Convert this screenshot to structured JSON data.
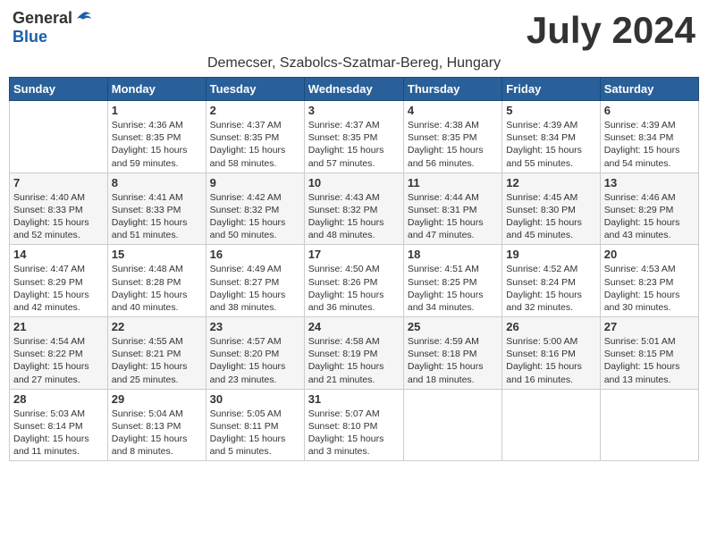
{
  "header": {
    "logo_general": "General",
    "logo_blue": "Blue",
    "month_year": "July 2024",
    "location": "Demecser, Szabolcs-Szatmar-Bereg, Hungary"
  },
  "days_of_week": [
    "Sunday",
    "Monday",
    "Tuesday",
    "Wednesday",
    "Thursday",
    "Friday",
    "Saturday"
  ],
  "weeks": [
    [
      {
        "num": "",
        "sunrise": "",
        "sunset": "",
        "daylight": ""
      },
      {
        "num": "1",
        "sunrise": "Sunrise: 4:36 AM",
        "sunset": "Sunset: 8:35 PM",
        "daylight": "Daylight: 15 hours and 59 minutes."
      },
      {
        "num": "2",
        "sunrise": "Sunrise: 4:37 AM",
        "sunset": "Sunset: 8:35 PM",
        "daylight": "Daylight: 15 hours and 58 minutes."
      },
      {
        "num": "3",
        "sunrise": "Sunrise: 4:37 AM",
        "sunset": "Sunset: 8:35 PM",
        "daylight": "Daylight: 15 hours and 57 minutes."
      },
      {
        "num": "4",
        "sunrise": "Sunrise: 4:38 AM",
        "sunset": "Sunset: 8:35 PM",
        "daylight": "Daylight: 15 hours and 56 minutes."
      },
      {
        "num": "5",
        "sunrise": "Sunrise: 4:39 AM",
        "sunset": "Sunset: 8:34 PM",
        "daylight": "Daylight: 15 hours and 55 minutes."
      },
      {
        "num": "6",
        "sunrise": "Sunrise: 4:39 AM",
        "sunset": "Sunset: 8:34 PM",
        "daylight": "Daylight: 15 hours and 54 minutes."
      }
    ],
    [
      {
        "num": "7",
        "sunrise": "Sunrise: 4:40 AM",
        "sunset": "Sunset: 8:33 PM",
        "daylight": "Daylight: 15 hours and 52 minutes."
      },
      {
        "num": "8",
        "sunrise": "Sunrise: 4:41 AM",
        "sunset": "Sunset: 8:33 PM",
        "daylight": "Daylight: 15 hours and 51 minutes."
      },
      {
        "num": "9",
        "sunrise": "Sunrise: 4:42 AM",
        "sunset": "Sunset: 8:32 PM",
        "daylight": "Daylight: 15 hours and 50 minutes."
      },
      {
        "num": "10",
        "sunrise": "Sunrise: 4:43 AM",
        "sunset": "Sunset: 8:32 PM",
        "daylight": "Daylight: 15 hours and 48 minutes."
      },
      {
        "num": "11",
        "sunrise": "Sunrise: 4:44 AM",
        "sunset": "Sunset: 8:31 PM",
        "daylight": "Daylight: 15 hours and 47 minutes."
      },
      {
        "num": "12",
        "sunrise": "Sunrise: 4:45 AM",
        "sunset": "Sunset: 8:30 PM",
        "daylight": "Daylight: 15 hours and 45 minutes."
      },
      {
        "num": "13",
        "sunrise": "Sunrise: 4:46 AM",
        "sunset": "Sunset: 8:29 PM",
        "daylight": "Daylight: 15 hours and 43 minutes."
      }
    ],
    [
      {
        "num": "14",
        "sunrise": "Sunrise: 4:47 AM",
        "sunset": "Sunset: 8:29 PM",
        "daylight": "Daylight: 15 hours and 42 minutes."
      },
      {
        "num": "15",
        "sunrise": "Sunrise: 4:48 AM",
        "sunset": "Sunset: 8:28 PM",
        "daylight": "Daylight: 15 hours and 40 minutes."
      },
      {
        "num": "16",
        "sunrise": "Sunrise: 4:49 AM",
        "sunset": "Sunset: 8:27 PM",
        "daylight": "Daylight: 15 hours and 38 minutes."
      },
      {
        "num": "17",
        "sunrise": "Sunrise: 4:50 AM",
        "sunset": "Sunset: 8:26 PM",
        "daylight": "Daylight: 15 hours and 36 minutes."
      },
      {
        "num": "18",
        "sunrise": "Sunrise: 4:51 AM",
        "sunset": "Sunset: 8:25 PM",
        "daylight": "Daylight: 15 hours and 34 minutes."
      },
      {
        "num": "19",
        "sunrise": "Sunrise: 4:52 AM",
        "sunset": "Sunset: 8:24 PM",
        "daylight": "Daylight: 15 hours and 32 minutes."
      },
      {
        "num": "20",
        "sunrise": "Sunrise: 4:53 AM",
        "sunset": "Sunset: 8:23 PM",
        "daylight": "Daylight: 15 hours and 30 minutes."
      }
    ],
    [
      {
        "num": "21",
        "sunrise": "Sunrise: 4:54 AM",
        "sunset": "Sunset: 8:22 PM",
        "daylight": "Daylight: 15 hours and 27 minutes."
      },
      {
        "num": "22",
        "sunrise": "Sunrise: 4:55 AM",
        "sunset": "Sunset: 8:21 PM",
        "daylight": "Daylight: 15 hours and 25 minutes."
      },
      {
        "num": "23",
        "sunrise": "Sunrise: 4:57 AM",
        "sunset": "Sunset: 8:20 PM",
        "daylight": "Daylight: 15 hours and 23 minutes."
      },
      {
        "num": "24",
        "sunrise": "Sunrise: 4:58 AM",
        "sunset": "Sunset: 8:19 PM",
        "daylight": "Daylight: 15 hours and 21 minutes."
      },
      {
        "num": "25",
        "sunrise": "Sunrise: 4:59 AM",
        "sunset": "Sunset: 8:18 PM",
        "daylight": "Daylight: 15 hours and 18 minutes."
      },
      {
        "num": "26",
        "sunrise": "Sunrise: 5:00 AM",
        "sunset": "Sunset: 8:16 PM",
        "daylight": "Daylight: 15 hours and 16 minutes."
      },
      {
        "num": "27",
        "sunrise": "Sunrise: 5:01 AM",
        "sunset": "Sunset: 8:15 PM",
        "daylight": "Daylight: 15 hours and 13 minutes."
      }
    ],
    [
      {
        "num": "28",
        "sunrise": "Sunrise: 5:03 AM",
        "sunset": "Sunset: 8:14 PM",
        "daylight": "Daylight: 15 hours and 11 minutes."
      },
      {
        "num": "29",
        "sunrise": "Sunrise: 5:04 AM",
        "sunset": "Sunset: 8:13 PM",
        "daylight": "Daylight: 15 hours and 8 minutes."
      },
      {
        "num": "30",
        "sunrise": "Sunrise: 5:05 AM",
        "sunset": "Sunset: 8:11 PM",
        "daylight": "Daylight: 15 hours and 5 minutes."
      },
      {
        "num": "31",
        "sunrise": "Sunrise: 5:07 AM",
        "sunset": "Sunset: 8:10 PM",
        "daylight": "Daylight: 15 hours and 3 minutes."
      },
      {
        "num": "",
        "sunrise": "",
        "sunset": "",
        "daylight": ""
      },
      {
        "num": "",
        "sunrise": "",
        "sunset": "",
        "daylight": ""
      },
      {
        "num": "",
        "sunrise": "",
        "sunset": "",
        "daylight": ""
      }
    ]
  ]
}
